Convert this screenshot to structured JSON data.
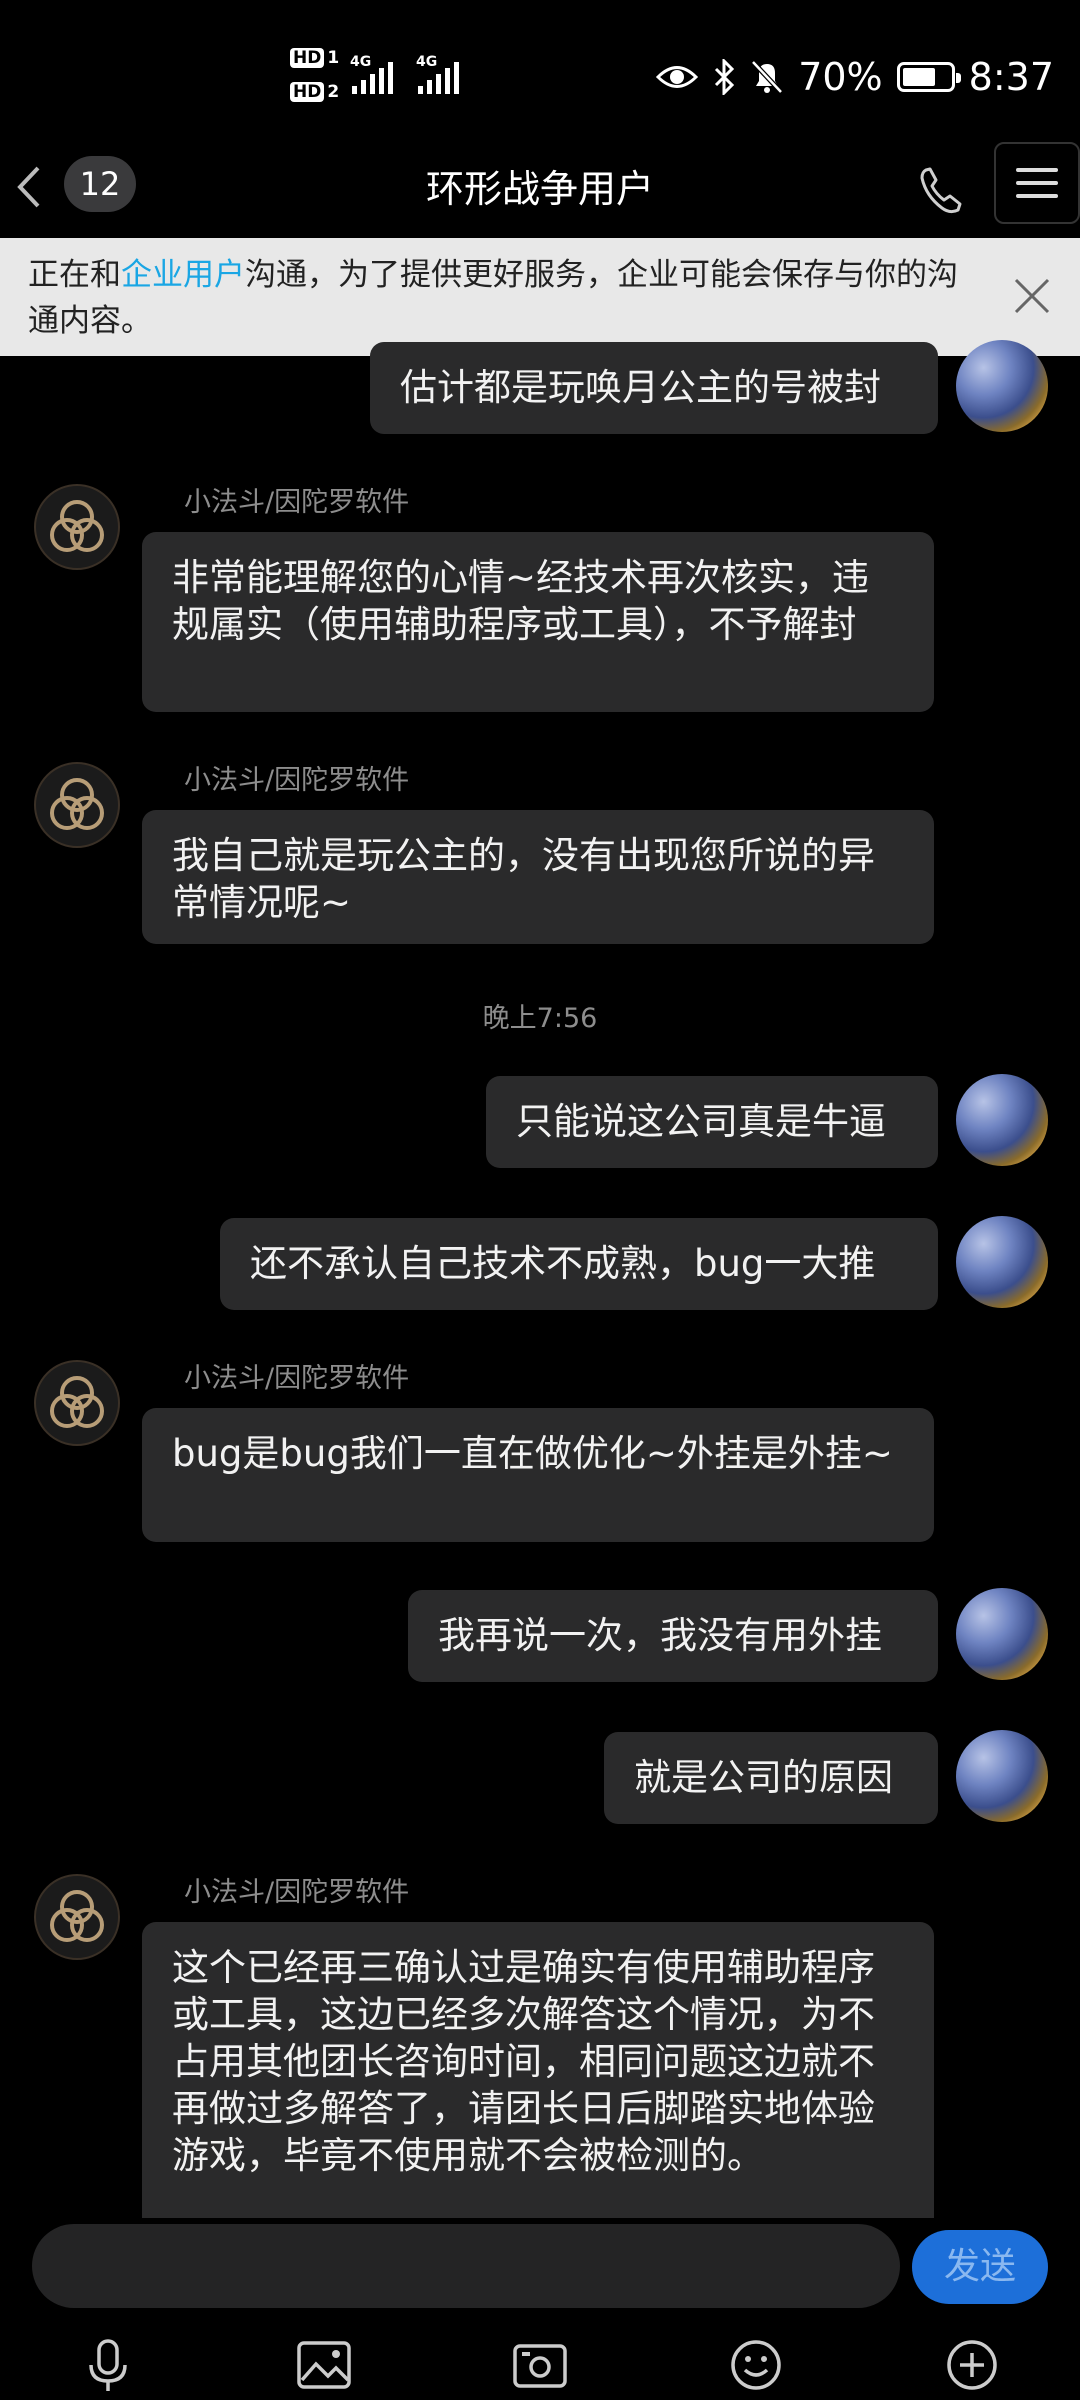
{
  "status_bar": {
    "hd1": "HD",
    "hd1_num": "1",
    "hd2": "HD",
    "hd2_num": "2",
    "net1": "4G",
    "net2": "4G",
    "battery": "70%",
    "battery_level": 0.7,
    "time": "8:37"
  },
  "header": {
    "unread_count": "12",
    "title": "环形战争用户"
  },
  "notice": {
    "prefix": "正在和",
    "link": "企业用户",
    "suffix": "沟通，为了提供更好服务，企业可能会保存与你的沟通内容。"
  },
  "messages": [
    {
      "from": "me",
      "text": "估计都是玩唤月公主的号被封"
    },
    {
      "from": "them",
      "sender": "小法斗/因陀罗软件",
      "text": "非常能理解您的心情~经技术再次核实，违规属实（使用辅助程序或工具），不予解封"
    },
    {
      "from": "them",
      "sender": "小法斗/因陀罗软件",
      "text": "我自己就是玩公主的，没有出现您所说的异常情况呢~"
    },
    {
      "from": "time",
      "text": "晚上7:56"
    },
    {
      "from": "me",
      "text": "只能说这公司真是牛逼"
    },
    {
      "from": "me",
      "text": "还不承认自己技术不成熟，bug一大推"
    },
    {
      "from": "them",
      "sender": "小法斗/因陀罗软件",
      "text": "bug是bug我们一直在做优化~外挂是外挂~"
    },
    {
      "from": "me",
      "text": "我再说一次，我没有用外挂"
    },
    {
      "from": "me",
      "text": "就是公司的原因"
    },
    {
      "from": "them",
      "sender": "小法斗/因陀罗软件",
      "text": "这个已经再三确认过是确实有使用辅助程序或工具，这边已经多次解答这个情况，为不占用其他团长咨询时间，相同问题这边就不再做过多解答了，请团长日后脚踏实地体验游戏，毕竟不使用就不会被检测的。"
    }
  ],
  "input": {
    "placeholder": "",
    "send_label": "发送"
  },
  "toolbar": [
    "microphone-icon",
    "image-icon",
    "camera-icon",
    "emoji-icon",
    "plus-icon"
  ],
  "colors": {
    "background": "#000000",
    "bubble": "#2a2a2b",
    "link": "#1aa6e4",
    "send_button": "#1d6fd9",
    "notice_bg": "#e8e8e8"
  }
}
